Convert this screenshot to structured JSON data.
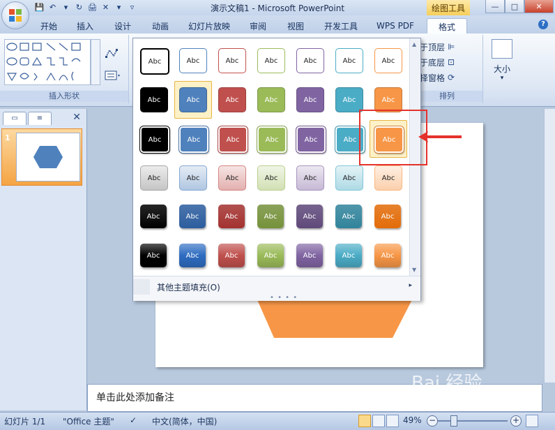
{
  "window": {
    "title": "演示文稿1 - Microsoft PowerPoint",
    "tool_context": "绘图工具",
    "min_glyph": "—",
    "max_glyph": "□",
    "close_glyph": "✕"
  },
  "qat": {
    "glyphs": [
      "💾",
      "↶",
      "▾",
      "↻",
      "🖨",
      "✕",
      "▾",
      "▿"
    ]
  },
  "tabs": [
    {
      "label": "开始"
    },
    {
      "label": "插入"
    },
    {
      "label": "设计"
    },
    {
      "label": "动画"
    },
    {
      "label": "幻灯片放映"
    },
    {
      "label": "审阅"
    },
    {
      "label": "视图"
    },
    {
      "label": "开发工具"
    },
    {
      "label": "WPS PDF"
    },
    {
      "label": "格式"
    }
  ],
  "active_tab": "格式",
  "ribbon": {
    "insert_shapes_label": "插入形状",
    "arrange_label": "排列",
    "bring_front": "置于顶层",
    "send_back": "置于底层",
    "selection_pane": "选择窗格",
    "size_label": "大小",
    "size_arrow": "▾",
    "help_glyph": "?"
  },
  "left_panel": {
    "tab1_glyph": "▭",
    "tab2_glyph": "≡",
    "close_glyph": "✕",
    "slide_number": "1",
    "thumb_shape_color": "#4f81bd"
  },
  "gallery": {
    "swatch_text": "Abc",
    "rows": [
      {
        "style": "outline",
        "colors": [
          "#000000",
          "#4f81bd",
          "#c0504d",
          "#9bbb59",
          "#8064a2",
          "#4bacc6",
          "#f79646"
        ]
      },
      {
        "style": "solid",
        "colors": [
          "#000000",
          "#4f81bd",
          "#c0504d",
          "#9bbb59",
          "#8064a2",
          "#4bacc6",
          "#f79646"
        ]
      },
      {
        "style": "solid-border",
        "colors": [
          "#000000",
          "#4f81bd",
          "#c0504d",
          "#9bbb59",
          "#8064a2",
          "#4bacc6",
          "#f79646"
        ]
      },
      {
        "style": "light",
        "colors": [
          "#7f7f7f",
          "#4f81bd",
          "#c0504d",
          "#9bbb59",
          "#8064a2",
          "#4bacc6",
          "#f79646"
        ]
      },
      {
        "style": "gradient",
        "colors": [
          "#000000",
          "#2c5d9e",
          "#a33230",
          "#76923c",
          "#5f497a",
          "#31849b",
          "#e36c09"
        ]
      },
      {
        "style": "gloss",
        "colors": [
          "#000000",
          "#2e6cc1",
          "#c0504d",
          "#9bbb59",
          "#8064a2",
          "#4bacc6",
          "#f79646"
        ]
      }
    ],
    "highlight_row": 1,
    "highlight_col": 1,
    "selected_row": 2,
    "selected_col": 6,
    "more_fill": "其他主题填充(O)",
    "more_fill_arrow": "▸",
    "scroll_up": "▲",
    "scroll_down": "▼",
    "gripper": "• • • •"
  },
  "slide": {
    "hexagon_color": "#f79646"
  },
  "notes": {
    "placeholder": "单击此处添加备注"
  },
  "status": {
    "slide_info": "幻灯片 1/1",
    "theme": "\"Office 主题\"",
    "language": "中文(简体，中国)",
    "zoom": "49%",
    "zoom_minus": "−",
    "zoom_plus": "+"
  },
  "watermark": "Bai 经验",
  "colors": {
    "accent_orange": "#f79646",
    "callout_red": "#e5312b"
  }
}
